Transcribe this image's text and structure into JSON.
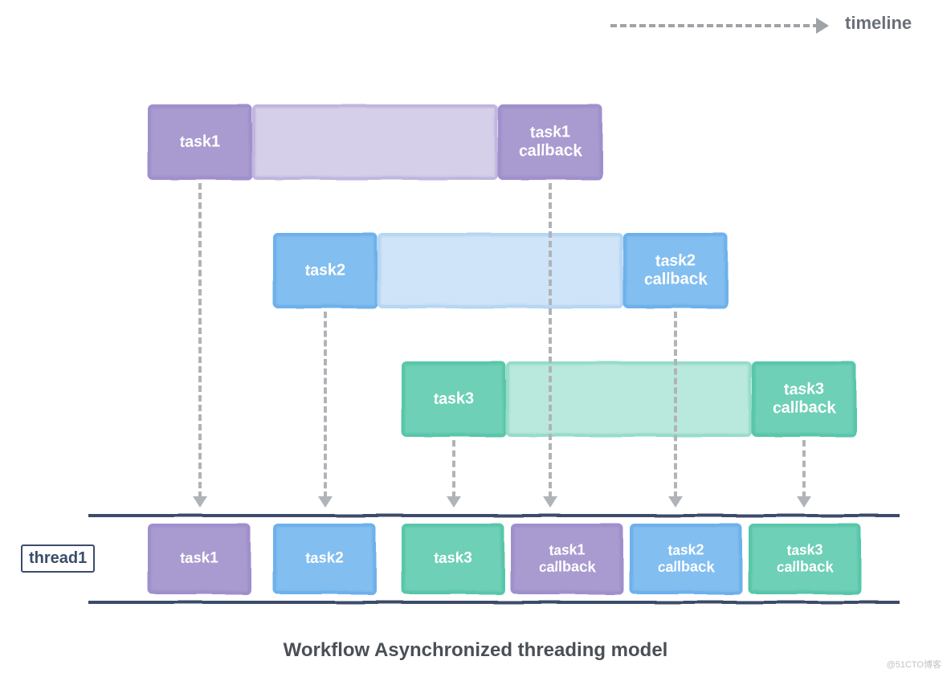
{
  "title": "Workflow Asynchronized threading model",
  "timeline_label": "timeline",
  "thread_label": "thread1",
  "watermark": "@51CTO博客",
  "colors": {
    "purple": "#a99bd0",
    "purple_light": "#d5cfe9",
    "blue": "#82bef0",
    "blue_light": "#cfe4f8",
    "teal": "#6ed0b6",
    "teal_light": "#b9e9dc",
    "rail": "#3c4c6a",
    "arrow": "#9fa2a7"
  },
  "rows": [
    {
      "task": {
        "label": "task1",
        "color": "purple"
      },
      "wait": {
        "color": "purple_light"
      },
      "callback": {
        "label": "task1\ncallback",
        "color": "purple"
      }
    },
    {
      "task": {
        "label": "task2",
        "color": "blue"
      },
      "wait": {
        "color": "blue_light"
      },
      "callback": {
        "label": "task2\ncallback",
        "color": "blue"
      }
    },
    {
      "task": {
        "label": "task3",
        "color": "teal"
      },
      "wait": {
        "color": "teal_light"
      },
      "callback": {
        "label": "task3\ncallback",
        "color": "teal"
      }
    }
  ],
  "thread_sequence": [
    {
      "label": "task1",
      "color": "purple"
    },
    {
      "label": "task2",
      "color": "blue"
    },
    {
      "label": "task3",
      "color": "teal"
    },
    {
      "label": "task1\ncallback",
      "color": "purple"
    },
    {
      "label": "task2\ncallback",
      "color": "blue"
    },
    {
      "label": "task3\ncallback",
      "color": "teal"
    }
  ]
}
